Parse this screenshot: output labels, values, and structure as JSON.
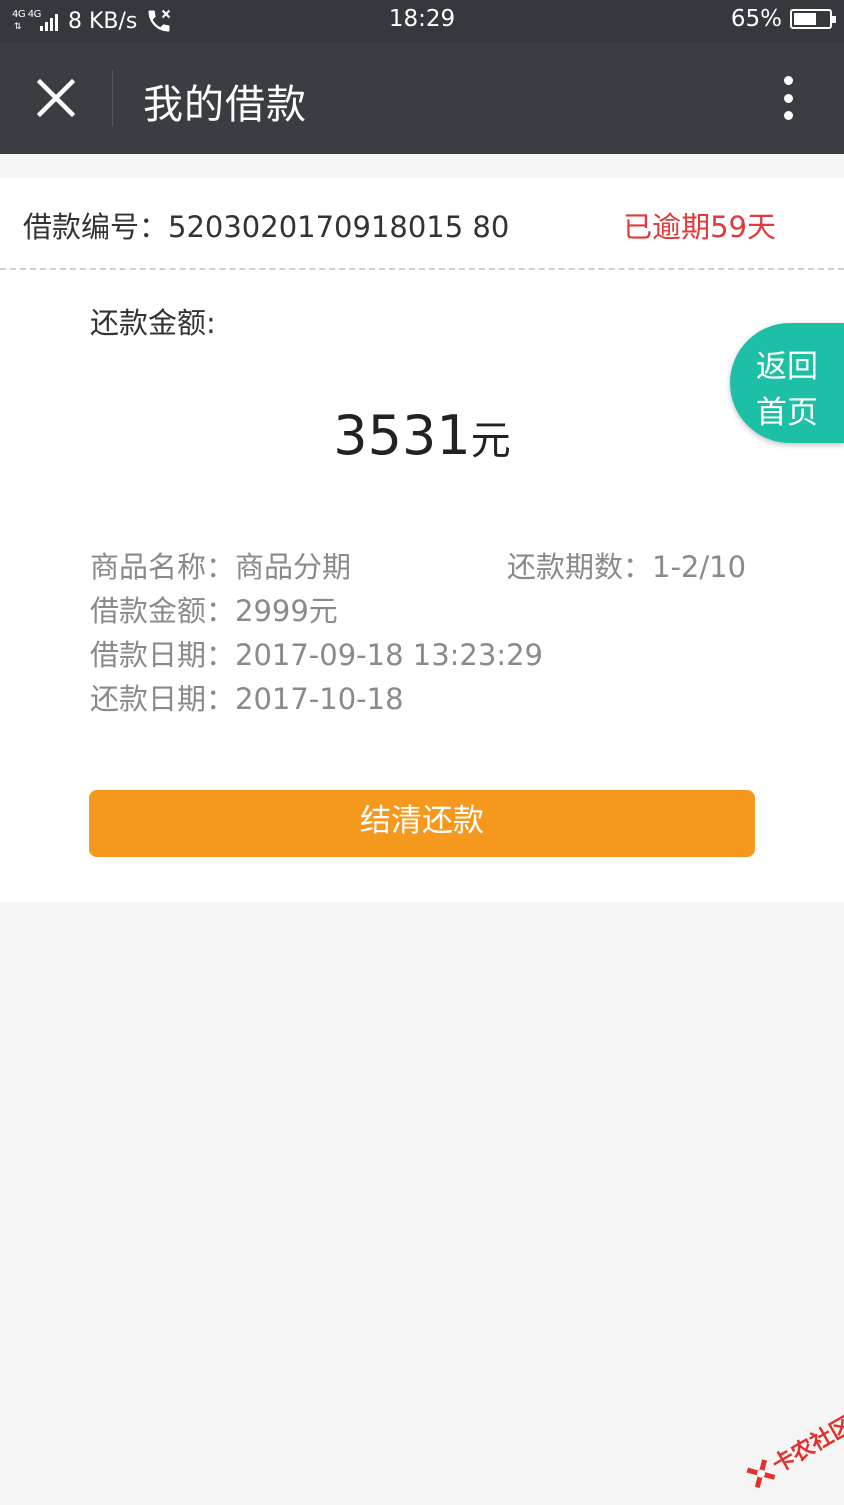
{
  "status_bar": {
    "network": "4G 4G",
    "speed": "8 KB/s",
    "time": "18:29",
    "battery": "65%",
    "battery_level": 0.65
  },
  "header": {
    "title": "我的借款"
  },
  "loan": {
    "number_label": "借款编号：5203020170918015 80",
    "status": "已逾期59天",
    "repay_amount_label": "还款金额:",
    "repay_amount": "3531",
    "repay_unit": "元",
    "product_name": "商品名称：商品分期",
    "installments": "还款期数：1-2/10",
    "loan_amount": "借款金额：2999元",
    "loan_date": "借款日期：2017-09-18 13:23:29",
    "repay_date": "还款日期：2017-10-18"
  },
  "actions": {
    "settle_label": "结清还款",
    "home_line1": "返回",
    "home_line2": "首页"
  },
  "watermark": {
    "text": "卡农社区"
  },
  "colors": {
    "status_bar_bg": "#35383d",
    "header_bg": "#3a3d42",
    "overdue_red": "#e03a3a",
    "button_orange": "#f5981e",
    "fab_teal": "#1dbfa6"
  }
}
